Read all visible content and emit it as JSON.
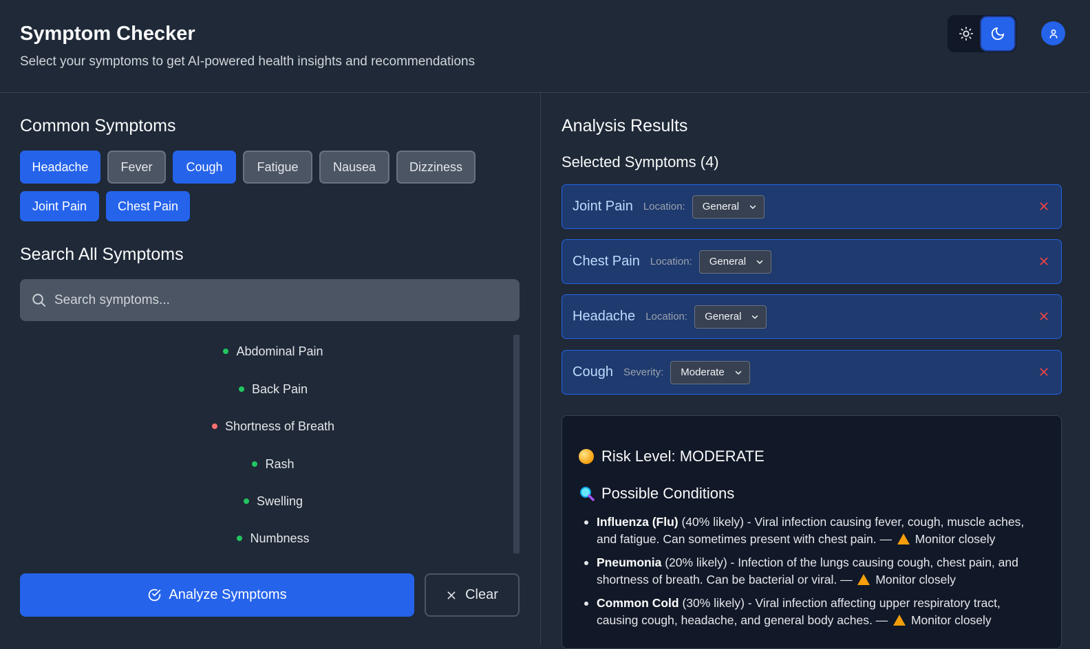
{
  "header": {
    "title": "Symptom Checker",
    "subtitle": "Select your symptoms to get AI-powered health insights and recommendations"
  },
  "icons": {
    "theme_light": "sun-icon",
    "theme_dark": "moon-icon",
    "avatar": "user-icon",
    "search": "search-icon",
    "analyze": "check-circle-icon",
    "clear": "close-icon",
    "remove": "close-icon",
    "risk": "yellow-circle-icon",
    "conditions": "magnifier-icon",
    "warning": "warning-icon"
  },
  "colors": {
    "accent": "#2563eb",
    "background": "#1f2937",
    "remove": "#ef4444",
    "low_risk_dot": "#22c55e",
    "high_risk_dot": "#f87171",
    "warning": "#f59e0b"
  },
  "left": {
    "common_heading": "Common Symptoms",
    "common_symptoms": [
      {
        "label": "Headache",
        "selected": true
      },
      {
        "label": "Fever",
        "selected": false
      },
      {
        "label": "Cough",
        "selected": true
      },
      {
        "label": "Fatigue",
        "selected": false
      },
      {
        "label": "Nausea",
        "selected": false
      },
      {
        "label": "Dizziness",
        "selected": false
      },
      {
        "label": "Joint Pain",
        "selected": true
      },
      {
        "label": "Chest Pain",
        "selected": true
      }
    ],
    "search_heading": "Search All Symptoms",
    "search_placeholder": "Search symptoms...",
    "symptom_list": [
      {
        "label": "Abdominal Pain",
        "dot": "green"
      },
      {
        "label": "Back Pain",
        "dot": "green"
      },
      {
        "label": "Shortness of Breath",
        "dot": "red"
      },
      {
        "label": "Rash",
        "dot": "green"
      },
      {
        "label": "Swelling",
        "dot": "green"
      },
      {
        "label": "Numbness",
        "dot": "green"
      }
    ],
    "analyze_label": "Analyze Symptoms",
    "clear_label": "Clear"
  },
  "right": {
    "heading": "Analysis Results",
    "selected_heading": "Selected Symptoms (4)",
    "selected": [
      {
        "name": "Joint Pain",
        "meta_label": "Location:",
        "value": "General"
      },
      {
        "name": "Chest Pain",
        "meta_label": "Location:",
        "value": "General"
      },
      {
        "name": "Headache",
        "meta_label": "Location:",
        "value": "General"
      },
      {
        "name": "Cough",
        "meta_label": "Severity:",
        "value": "Moderate"
      }
    ],
    "risk_label": "Risk Level: MODERATE",
    "conditions_heading": "Possible Conditions",
    "conditions": [
      {
        "name": "Influenza (Flu)",
        "likelihood": "(40% likely)",
        "desc": " - Viral infection causing fever, cough, muscle aches, and fatigue. Can sometimes present with chest pain. — ",
        "advice": "Monitor closely"
      },
      {
        "name": "Pneumonia",
        "likelihood": "(20% likely)",
        "desc": " - Infection of the lungs causing cough, chest pain, and shortness of breath. Can be bacterial or viral. — ",
        "advice": "Monitor closely"
      },
      {
        "name": "Common Cold",
        "likelihood": "(30% likely)",
        "desc": " - Viral infection affecting upper respiratory tract, causing cough, headache, and general body aches. — ",
        "advice": "Monitor closely"
      }
    ]
  }
}
